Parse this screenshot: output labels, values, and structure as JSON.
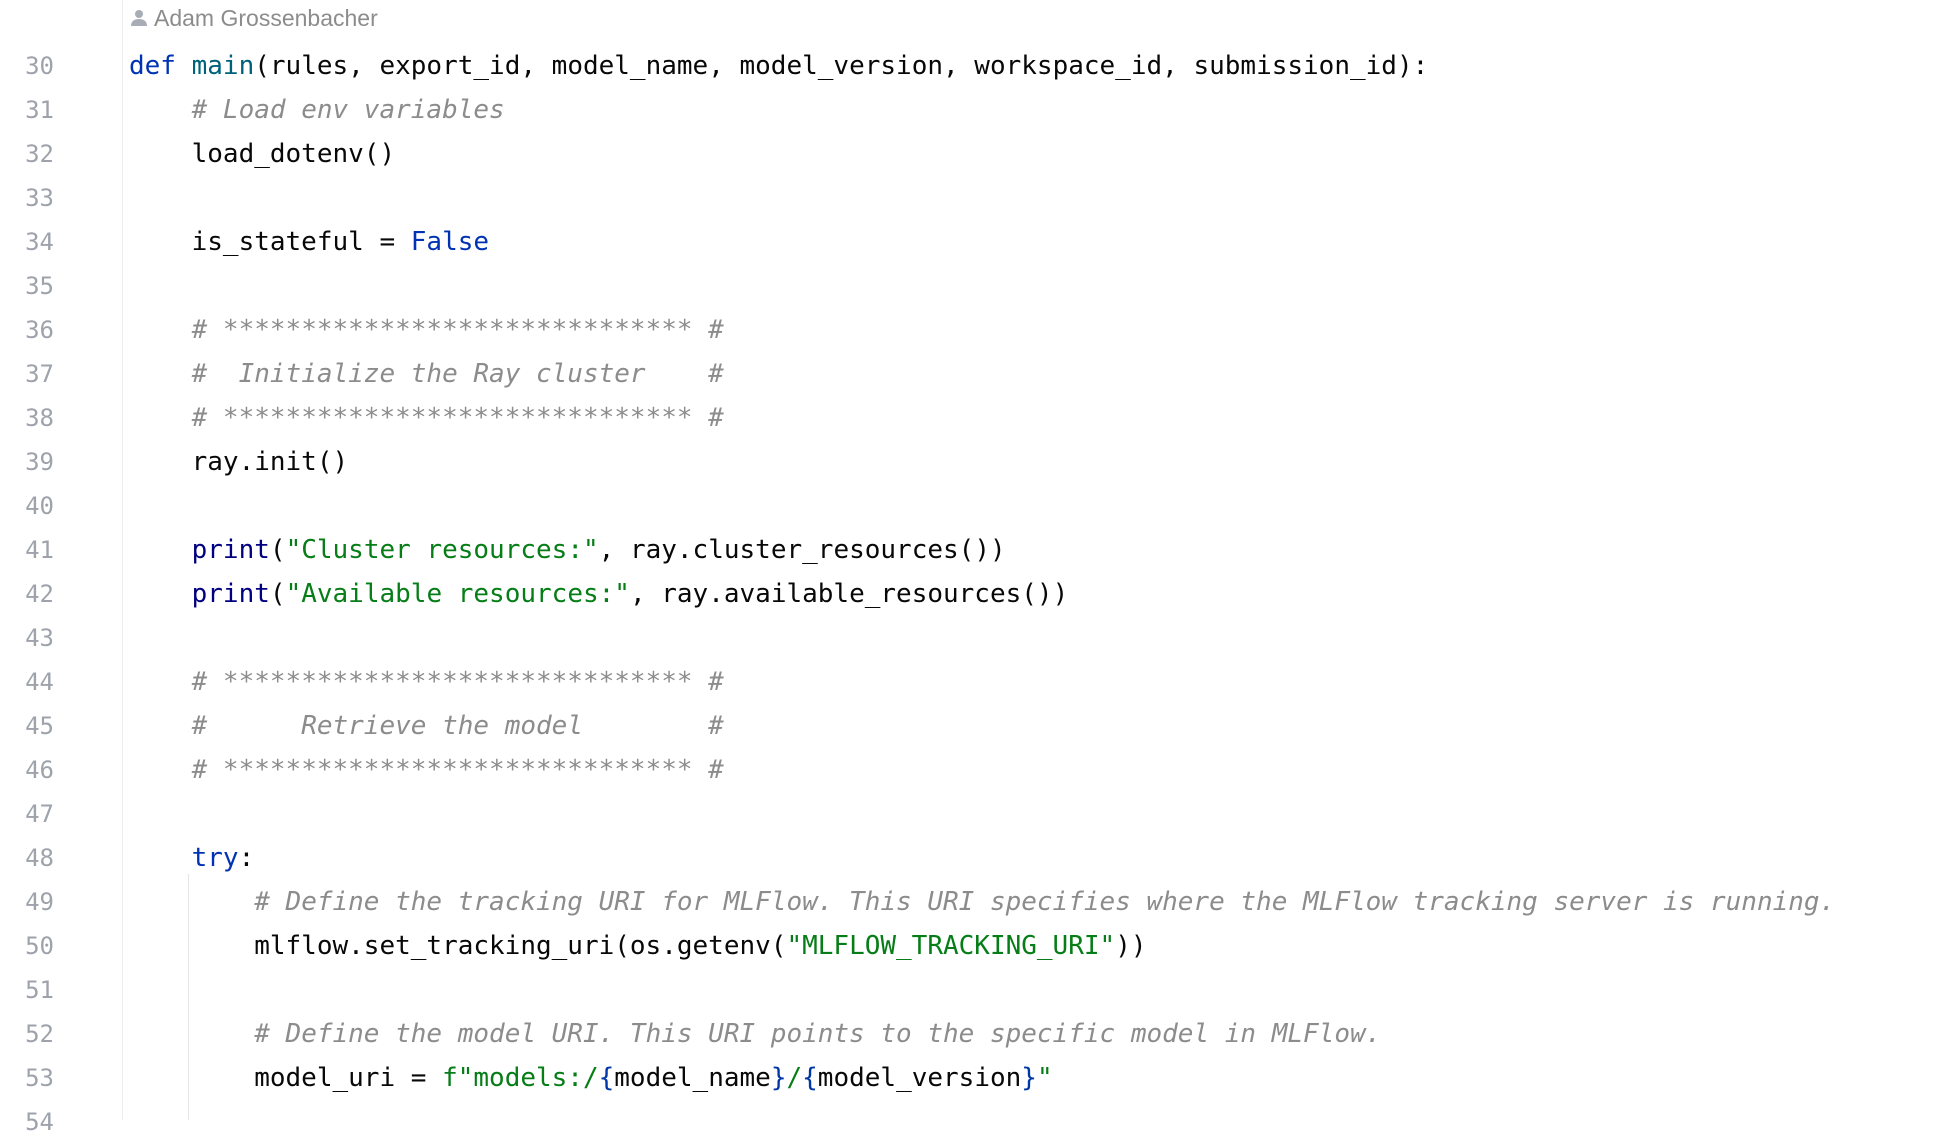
{
  "author": {
    "icon": "person-icon",
    "name": "Adam Grossenbacher"
  },
  "colors": {
    "keyword": "#0033b3",
    "function_name": "#00627a",
    "builtin": "#000080",
    "string": "#067d17",
    "comment": "#8c8c8c",
    "text": "#080808",
    "line_number": "#9ea3ab"
  },
  "lines": [
    {
      "n": "30",
      "tokens": [
        {
          "t": "def",
          "c": "kw"
        },
        {
          "t": " ",
          "c": ""
        },
        {
          "t": "main",
          "c": "fn"
        },
        {
          "t": "(rules, export_id, model_name, model_version, workspace_id, submission_id):",
          "c": ""
        }
      ]
    },
    {
      "n": "31",
      "tokens": [
        {
          "t": "    ",
          "c": ""
        },
        {
          "t": "# Load env variables",
          "c": "cmt"
        }
      ]
    },
    {
      "n": "32",
      "tokens": [
        {
          "t": "    load_dotenv()",
          "c": ""
        }
      ]
    },
    {
      "n": "33",
      "tokens": []
    },
    {
      "n": "34",
      "tokens": [
        {
          "t": "    is_stateful = ",
          "c": ""
        },
        {
          "t": "False",
          "c": "kw"
        }
      ]
    },
    {
      "n": "35",
      "tokens": []
    },
    {
      "n": "36",
      "tokens": [
        {
          "t": "    ",
          "c": ""
        },
        {
          "t": "# ****************************** #",
          "c": "cmt"
        }
      ]
    },
    {
      "n": "37",
      "tokens": [
        {
          "t": "    ",
          "c": ""
        },
        {
          "t": "#  Initialize the Ray cluster    #",
          "c": "cmt"
        }
      ]
    },
    {
      "n": "38",
      "tokens": [
        {
          "t": "    ",
          "c": ""
        },
        {
          "t": "# ****************************** #",
          "c": "cmt"
        }
      ]
    },
    {
      "n": "39",
      "tokens": [
        {
          "t": "    ray.init()",
          "c": ""
        }
      ]
    },
    {
      "n": "40",
      "tokens": []
    },
    {
      "n": "41",
      "tokens": [
        {
          "t": "    ",
          "c": ""
        },
        {
          "t": "print",
          "c": "bi"
        },
        {
          "t": "(",
          "c": ""
        },
        {
          "t": "\"Cluster resources:\"",
          "c": "str"
        },
        {
          "t": ", ray.cluster_resources())",
          "c": ""
        }
      ]
    },
    {
      "n": "42",
      "tokens": [
        {
          "t": "    ",
          "c": ""
        },
        {
          "t": "print",
          "c": "bi"
        },
        {
          "t": "(",
          "c": ""
        },
        {
          "t": "\"Available resources:\"",
          "c": "str"
        },
        {
          "t": ", ray.available_resources())",
          "c": ""
        }
      ]
    },
    {
      "n": "43",
      "tokens": []
    },
    {
      "n": "44",
      "tokens": [
        {
          "t": "    ",
          "c": ""
        },
        {
          "t": "# ****************************** #",
          "c": "cmt"
        }
      ]
    },
    {
      "n": "45",
      "tokens": [
        {
          "t": "    ",
          "c": ""
        },
        {
          "t": "#      Retrieve the model        #",
          "c": "cmt"
        }
      ]
    },
    {
      "n": "46",
      "tokens": [
        {
          "t": "    ",
          "c": ""
        },
        {
          "t": "# ****************************** #",
          "c": "cmt"
        }
      ]
    },
    {
      "n": "47",
      "tokens": []
    },
    {
      "n": "48",
      "tokens": [
        {
          "t": "    ",
          "c": ""
        },
        {
          "t": "try",
          "c": "kw"
        },
        {
          "t": ":",
          "c": ""
        }
      ]
    },
    {
      "n": "49",
      "tokens": [
        {
          "t": "        ",
          "c": ""
        },
        {
          "t": "# Define the tracking URI for MLFlow. This URI specifies where the MLFlow tracking server is running.",
          "c": "cmt"
        }
      ]
    },
    {
      "n": "50",
      "tokens": [
        {
          "t": "        mlflow.set_tracking_uri(os.getenv(",
          "c": ""
        },
        {
          "t": "\"MLFLOW_TRACKING_URI\"",
          "c": "str"
        },
        {
          "t": "))",
          "c": ""
        }
      ]
    },
    {
      "n": "51",
      "tokens": []
    },
    {
      "n": "52",
      "tokens": [
        {
          "t": "        ",
          "c": ""
        },
        {
          "t": "# Define the model URI. This URI points to the specific model in MLFlow.",
          "c": "cmt"
        }
      ]
    },
    {
      "n": "53",
      "tokens": [
        {
          "t": "        model_uri = ",
          "c": ""
        },
        {
          "t": "f\"models:/",
          "c": "str"
        },
        {
          "t": "{",
          "c": "fbr"
        },
        {
          "t": "model_name",
          "c": ""
        },
        {
          "t": "}",
          "c": "fbr"
        },
        {
          "t": "/",
          "c": "str"
        },
        {
          "t": "{",
          "c": "fbr"
        },
        {
          "t": "model_version",
          "c": ""
        },
        {
          "t": "}",
          "c": "fbr"
        },
        {
          "t": "\"",
          "c": "str"
        }
      ]
    },
    {
      "n": "54",
      "tokens": []
    }
  ]
}
